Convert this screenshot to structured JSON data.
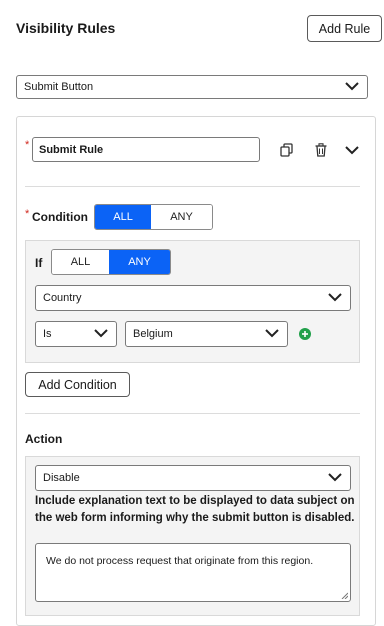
{
  "header": {
    "title": "Visibility Rules",
    "add_rule_label": "Add Rule"
  },
  "target_select": {
    "value": "Submit Button"
  },
  "rule": {
    "name_value": "Submit Rule",
    "condition_label": "Condition",
    "condition_toggle": {
      "options": [
        "ALL",
        "ANY"
      ],
      "selected": "ALL"
    },
    "if_label": "If",
    "if_toggle": {
      "options": [
        "ALL",
        "ANY"
      ],
      "selected": "ANY"
    },
    "field_select": "Country",
    "operator_select": "Is",
    "value_select": "Belgium",
    "add_condition_label": "Add Condition",
    "action_label": "Action",
    "action_select": "Disable",
    "explanation_label": "Include explanation text to be displayed to data subject on the web form informing why the submit button is disabled.",
    "explanation_text": "We do not process request that originate from this region."
  },
  "colors": {
    "accent": "#0b63f6",
    "required": "#d0271d",
    "add_icon": "#21a04a"
  }
}
